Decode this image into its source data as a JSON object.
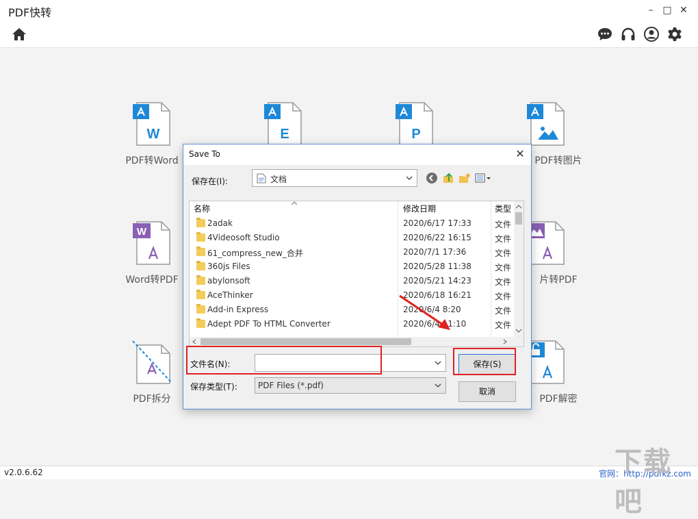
{
  "app": {
    "title": "PDF快转",
    "version": "v2.0.6.62",
    "website": "官网：http://pdfkz.com",
    "watermark": "下载吧"
  },
  "window_controls": {
    "minimize": "–",
    "maximize": "□",
    "close": "✕"
  },
  "tools": [
    {
      "label": "PDF转Word",
      "letter": "W"
    },
    {
      "label": "",
      "letter": "E"
    },
    {
      "label": "",
      "letter": "P"
    },
    {
      "label": "PDF转图片",
      "letter": ""
    },
    {
      "label": "Word转PDF",
      "letter": "W"
    },
    {
      "label": "片转PDF",
      "letter": ""
    },
    {
      "label": "PDF拆分",
      "letter": ""
    },
    {
      "label": "PDF解密",
      "letter": ""
    }
  ],
  "dialog": {
    "title": "Save To",
    "close": "✕",
    "save_in_label": "保存在(I):",
    "save_in_value": "文档",
    "columns": {
      "name": "名称",
      "date": "修改日期",
      "type": "类型"
    },
    "files": [
      {
        "name": "2adak",
        "date": "2020/6/17 17:33",
        "type": "文件"
      },
      {
        "name": "4Videosoft Studio",
        "date": "2020/6/22 16:15",
        "type": "文件"
      },
      {
        "name": "61_compress_new_合并",
        "date": "2020/7/1 17:36",
        "type": "文件"
      },
      {
        "name": "360js Files",
        "date": "2020/5/28 11:38",
        "type": "文件"
      },
      {
        "name": "abylonsoft",
        "date": "2020/5/21 14:23",
        "type": "文件"
      },
      {
        "name": "AceThinker",
        "date": "2020/6/18 16:21",
        "type": "文件"
      },
      {
        "name": "Add-in Express",
        "date": "2020/6/4 8:20",
        "type": "文件"
      },
      {
        "name": "Adept PDF To HTML Converter",
        "date": "2020/6/4 11:10",
        "type": "文件"
      }
    ],
    "filename_label": "文件名(N):",
    "filename_value": "",
    "filetype_label": "保存类型(T):",
    "filetype_value": "PDF Files (*.pdf)",
    "save_button": "保存(S)",
    "cancel_button": "取消"
  },
  "colors": {
    "pdf_blue": "#1e88d8",
    "pdf_purple": "#8a5fb4",
    "annotation_red": "#e02020"
  }
}
